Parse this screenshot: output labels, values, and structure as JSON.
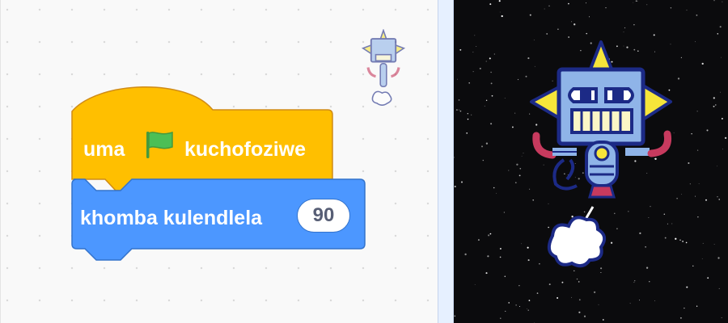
{
  "hat_block": {
    "label_before": "uma",
    "label_after": "kuchofoziwe",
    "icon": "green-flag-icon",
    "color": "#ffbf00",
    "border_color": "#cf8b17"
  },
  "motion_block": {
    "label": "khomba kulendlela",
    "value": "90",
    "color": "#4c97ff",
    "border_color": "#3373cc"
  },
  "stage": {
    "background": "space-starfield",
    "sprite": "robot-sprite-icon"
  },
  "colors": {
    "flag": "#4cbf56",
    "robot_body": "#8fb4e8",
    "robot_outline": "#1c2a86",
    "robot_star": "#f6e53a"
  }
}
